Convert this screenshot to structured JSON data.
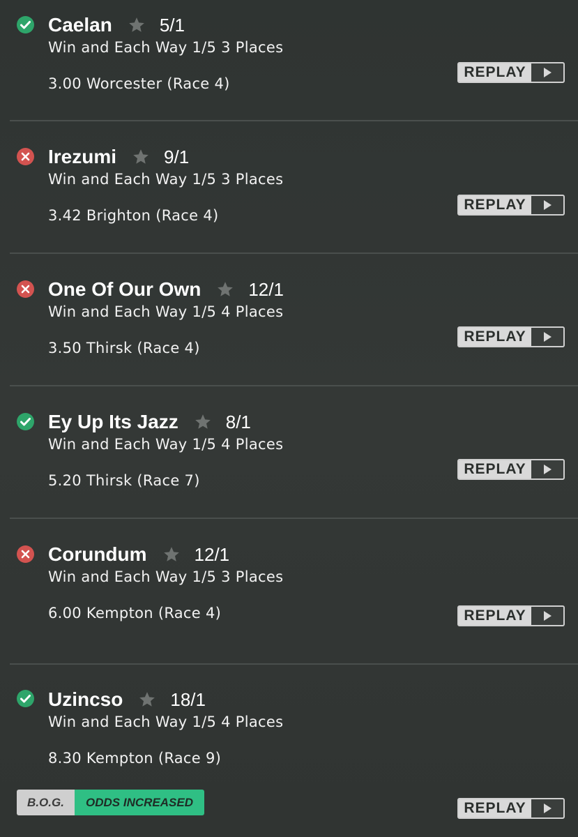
{
  "replay_label": "REPLAY",
  "bets": [
    {
      "status": "won",
      "horse": "Caelan",
      "odds": "5/1",
      "market": "Win and Each Way 1/5 3 Places",
      "race": "3.00 Worcester (Race 4)"
    },
    {
      "status": "lost",
      "horse": "Irezumi",
      "odds": "9/1",
      "market": "Win and Each Way 1/5 3 Places",
      "race": "3.42 Brighton (Race 4)"
    },
    {
      "status": "lost",
      "horse": "One Of Our Own",
      "odds": "12/1",
      "market": "Win and Each Way 1/5 4 Places",
      "race": "3.50 Thirsk (Race 4)"
    },
    {
      "status": "won",
      "horse": "Ey Up Its Jazz",
      "odds": "8/1",
      "market": "Win and Each Way 1/5 4 Places",
      "race": "5.20 Thirsk (Race 7)"
    },
    {
      "status": "lost",
      "horse": "Corundum",
      "odds": "12/1",
      "market": "Win and Each Way 1/5 3 Places",
      "race": "6.00 Kempton (Race 4)"
    },
    {
      "status": "won",
      "horse": "Uzincso",
      "odds": "18/1",
      "market": "Win and Each Way 1/5 4 Places",
      "race": "8.30 Kempton (Race 9)"
    }
  ],
  "bog_badge": {
    "label": "B.O.G.",
    "status": "ODDS INCREASED"
  },
  "colors": {
    "won": "#2ea56a",
    "lost": "#d35350",
    "odds_increased": "#2fbf84"
  },
  "icons": {
    "won": "check-circle-icon",
    "lost": "x-circle-icon",
    "favourite": "star-icon",
    "play": "play-icon"
  }
}
